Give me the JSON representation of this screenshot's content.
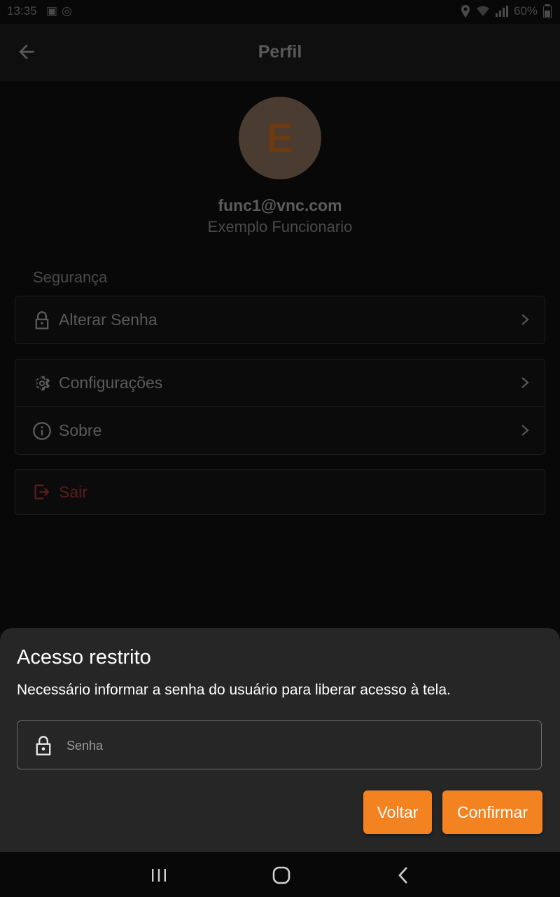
{
  "status_bar": {
    "time": "13:35",
    "battery": "60%"
  },
  "app_bar": {
    "title": "Perfil"
  },
  "profile": {
    "avatar_initial": "E",
    "email": "func1@vnc.com",
    "name": "Exemplo Funcionario"
  },
  "security": {
    "section_label": "Segurança",
    "change_password_label": "Alterar Senha"
  },
  "menu": {
    "settings_label": "Configurações",
    "about_label": "Sobre",
    "logout_label": "Sair"
  },
  "dialog": {
    "title": "Acesso restrito",
    "description": "Necessário informar a senha do usuário para liberar acesso à tela.",
    "password_placeholder": "Senha",
    "back_label": "Voltar",
    "confirm_label": "Confirmar"
  },
  "colors": {
    "accent": "#f38220",
    "sheet_background": "#262626",
    "logout": "#d32f2f"
  },
  "icons": [
    "back-arrow-icon",
    "lock-icon",
    "gear-icon",
    "info-icon",
    "logout-icon",
    "chevron-right-icon",
    "recents-icon",
    "home-icon",
    "nav-back-icon"
  ]
}
